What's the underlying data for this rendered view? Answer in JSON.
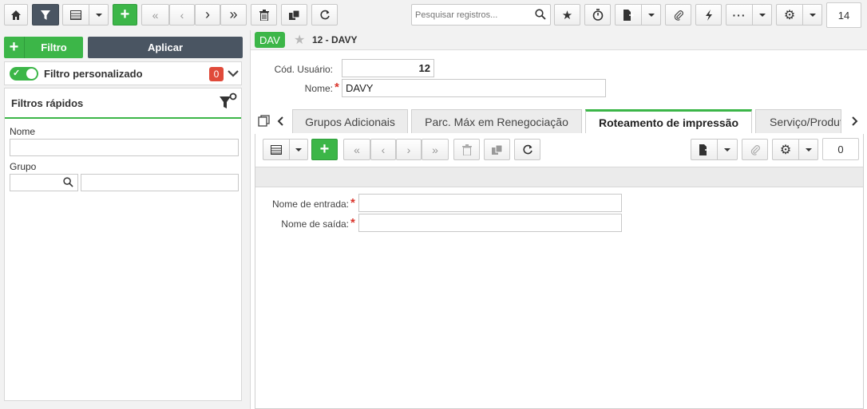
{
  "toolbar": {
    "search_placeholder": "Pesquisar registros...",
    "record_count": "14"
  },
  "left_panel": {
    "filter_button_label": "Filtro",
    "apply_button_label": "Aplicar",
    "custom_filter_label": "Filtro personalizado",
    "custom_filter_count": "0",
    "quick_filters_title": "Filtros rápidos",
    "fields": [
      {
        "label": "Nome",
        "value": ""
      },
      {
        "label": "Grupo",
        "value": ""
      }
    ]
  },
  "record": {
    "tag": "DAV",
    "title": "12 - DAVY",
    "user_code_label": "Cód. Usuário:",
    "user_code_value": "12",
    "name_label": "Nome:",
    "name_value": "DAVY"
  },
  "tabs": [
    {
      "label": "Grupos Adicionais",
      "active": false
    },
    {
      "label": "Parc. Máx em Renegociação",
      "active": false
    },
    {
      "label": "Roteamento de impressão",
      "active": true
    },
    {
      "label": "Serviço/Produto",
      "active": false
    }
  ],
  "subform": {
    "record_count": "0",
    "input_name_label": "Nome de entrada:",
    "input_name_value": "",
    "output_name_label": "Nome de saída:",
    "output_name_value": ""
  },
  "colors": {
    "accent": "#3cb648",
    "dark": "#4a5562",
    "badge": "#e04a3a",
    "required": "#d9342b"
  }
}
